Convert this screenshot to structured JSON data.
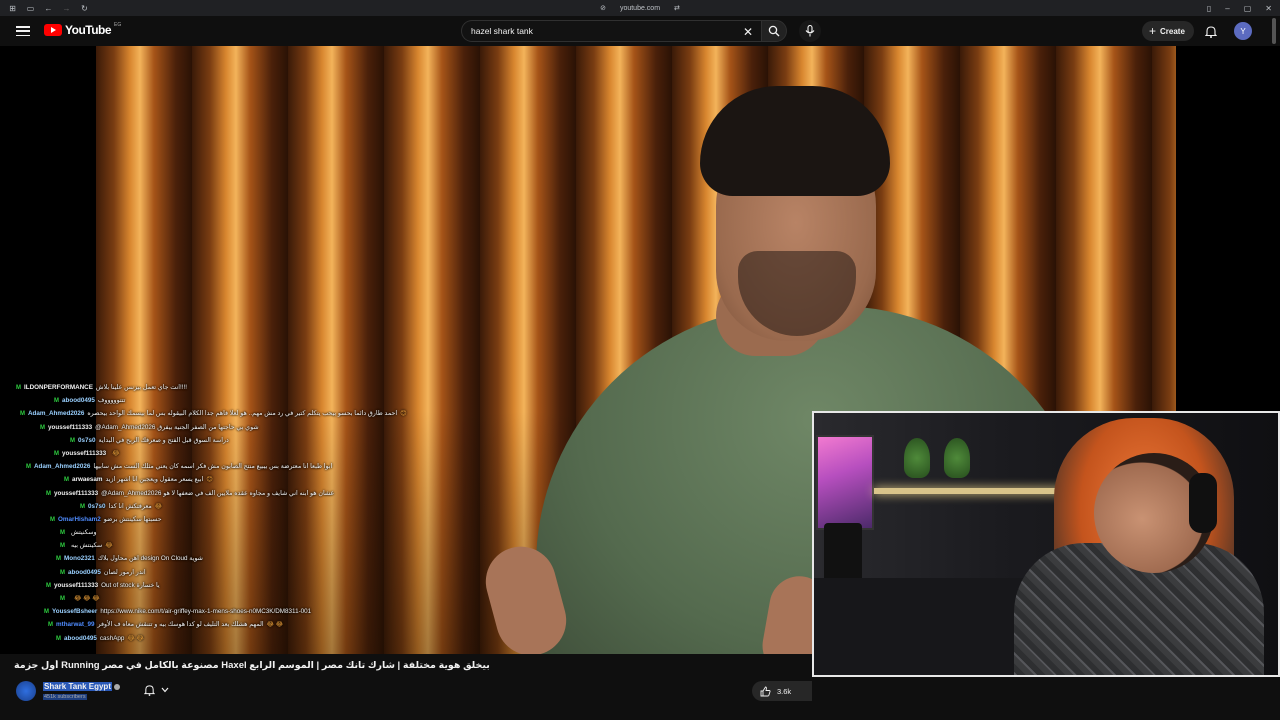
{
  "browser": {
    "url": "youtube.com"
  },
  "header": {
    "logo_text": "YouTube",
    "country_code": "EG",
    "search_value": "hazel shark tank",
    "create_label": "Create",
    "avatar_letter": "Y"
  },
  "chat": [
    {
      "user": "ILDONPERFORMANCE",
      "msg": "انت جاي تعمل بيزنس علينا بلاش!!!!",
      "user_color": "#f1f1f1",
      "badge": true
    },
    {
      "user": "abood0495",
      "msg": "تتتوووووف",
      "user_color": "#9ad0ff",
      "badge": true
    },
    {
      "user": "Adam_Ahmed2026",
      "msg": "احمد طارق دائما بحسو بيحب يتكلم كتير في رد مش مهم.. هو لعلا فاهم جدا الكلام البيقوله بس لما بيسمك الواحد بيحصره",
      "user_color": "#9ad0ff",
      "badge": true,
      "emo": "😊"
    },
    {
      "user": "youssef111333",
      "msg": "@Adam_Ahmed2026 شوي بي حاجتها من الصفر الجنية بيفرق",
      "user_color": "#f1f1f1",
      "badge": true
    },
    {
      "user": "0s7s0",
      "msg": "دراسة السوق قبل الفتح و صعرفك الربح في البداية",
      "user_color": "#9ad0ff",
      "badge": true
    },
    {
      "user": "youssef111333",
      "msg": "",
      "user_color": "#f1f1f1",
      "badge": true,
      "emo": "😂"
    },
    {
      "user": "Adam_Ahmed2026",
      "msg": "ابوا طبعا انا معترضة بس بيبيع منتج الصابون مش فكر اسمه كان يعني مثلك الست مش سابيها",
      "user_color": "#9ad0ff",
      "badge": true
    },
    {
      "user": "arwaesam",
      "msg": "ابيع يسعر معقول ويعجبن انا اشهر ازيد",
      "user_color": "#f1f1f1",
      "badge": true,
      "emo": "😊"
    },
    {
      "user": "youssef111333",
      "msg": "@Adam_Ahmed2026 عشان هو ابنه اني شايف و مجاوه عقده ملايين الف في ضعفها لا هو",
      "user_color": "#f1f1f1",
      "badge": true
    },
    {
      "user": "0s7s0",
      "msg": "معرفتكش انا كدا",
      "user_color": "#9ad0ff",
      "badge": true,
      "emo": "😂"
    },
    {
      "user": "OmarHisham2",
      "msg": "حسبتها سكينتش برضو",
      "user_color": "#4f8cff",
      "badge": true
    },
    {
      "user": "",
      "msg": "وسكنيتش",
      "user_color": "#e53935",
      "badge": true
    },
    {
      "user": "",
      "msg": "سكينتش بيه",
      "user_color": "#e53935",
      "badge": true,
      "emo": "😂"
    },
    {
      "user": "Mono2321",
      "msg": "اهن محاول بلاك design On Cloud شوية",
      "user_color": "#9ad0ff",
      "badge": true
    },
    {
      "user": "abood0495",
      "msg": "اندر ارمور لصان",
      "user_color": "#9ad0ff",
      "badge": true
    },
    {
      "user": "youssef111333",
      "msg": "Out of stock يا خسارة",
      "user_color": "#f1f1f1",
      "badge": true
    },
    {
      "user": "",
      "msg": "",
      "user_color": "#e53935",
      "badge": true,
      "emo": "😂 😂 😂"
    },
    {
      "user": "YoussefBsheer",
      "msg": "https://www.nike.com/t/air-griffey-max-1-mens-shoes-n0MC3K/DM8311-001",
      "user_color": "#9ad0ff",
      "badge": true
    },
    {
      "user": "mtharwat_99",
      "msg": "المهم هشلك بعد التليف لو كدا هوسك بيه و تتنقش معاه ف الأوفر",
      "user_color": "#4f8cff",
      "badge": true,
      "emo": "😂 😂"
    },
    {
      "user": "abood0495",
      "msg": "cashApp",
      "user_color": "#9ad0ff",
      "badge": true,
      "emo": "😂 😂"
    }
  ],
  "video": {
    "title": "بيخلق هوية مختلفة | شارك تانك مصر | الموسم الرابع Haxel مصنوعة بالكامل في مصر Running أول جزمة"
  },
  "channel": {
    "name": "Shark Tank Egypt",
    "subscribers": "451k subscribers"
  },
  "actions": {
    "likes": "3.6k"
  }
}
